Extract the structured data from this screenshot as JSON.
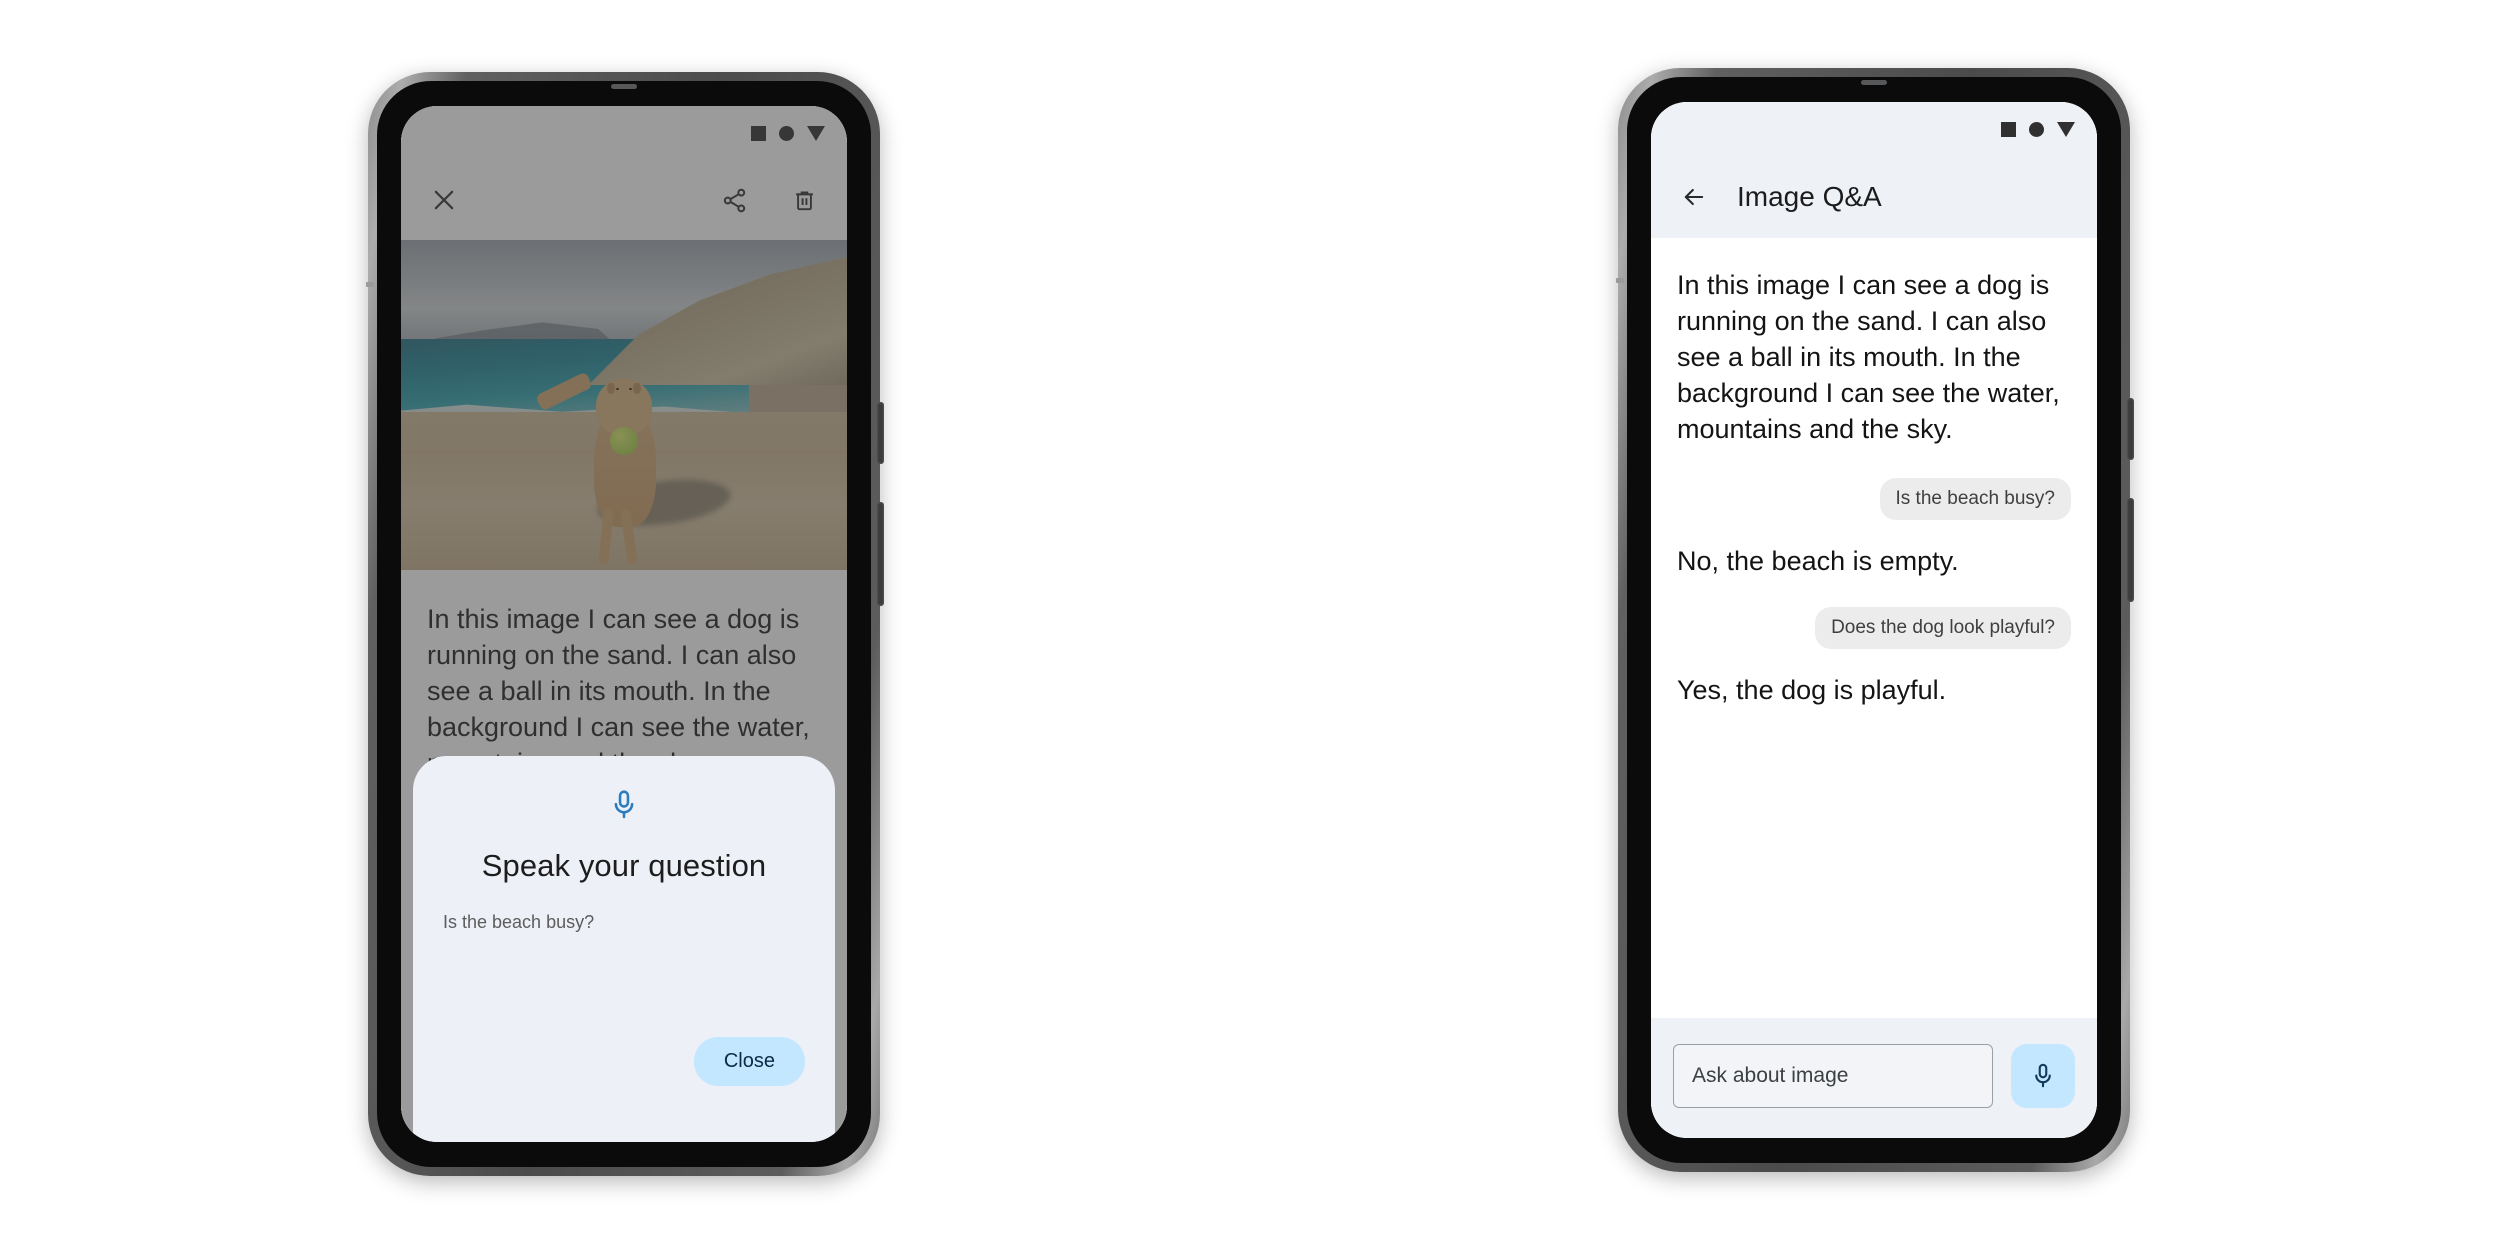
{
  "left_phone": {
    "name": "image-viewer-phone",
    "status_bar": {
      "icons": [
        "square-icon",
        "circle-icon",
        "triangle-icon"
      ]
    },
    "toolbar": {
      "close_icon": "close-icon",
      "share_icon": "share-icon",
      "delete_icon": "trash-icon"
    },
    "photo": {
      "alt": "A golden dog running on the sand of a beach with a green ball in its mouth, sea and cliffs behind"
    },
    "description": "In this image I can see a dog is running on the sand. I can also see a ball in its mouth. In the background I can see the water, mountains and the sky.",
    "voice_sheet": {
      "mic_icon": "microphone-icon",
      "title": "Speak your question",
      "transcript": "Is the beach busy?",
      "close_label": "Close"
    }
  },
  "right_phone": {
    "name": "image-qa-phone",
    "status_bar": {
      "icons": [
        "square-icon",
        "circle-icon",
        "triangle-icon"
      ]
    },
    "appbar": {
      "back_icon": "back-arrow-icon",
      "title": "Image Q&A"
    },
    "description": "In this image I can see a dog is running on the sand. I can also see a ball in its mouth. In the background I can see the water, mountains and the sky.",
    "conversation": [
      {
        "role": "user",
        "text": "Is the beach busy?"
      },
      {
        "role": "assistant",
        "text": "No, the beach is empty."
      },
      {
        "role": "user",
        "text": "Does the dog look playful?"
      },
      {
        "role": "assistant",
        "text": "Yes, the dog is playful."
      }
    ],
    "input_bar": {
      "placeholder": "Ask about image",
      "value": "",
      "mic_icon": "microphone-icon"
    }
  },
  "colors": {
    "accent_blue": "#1a73e8",
    "button_blue": "#c2e7ff",
    "appbar_bg": "#eef1f6",
    "bubble_bg": "#ececec",
    "sheet_bg": "#eef0f8"
  }
}
